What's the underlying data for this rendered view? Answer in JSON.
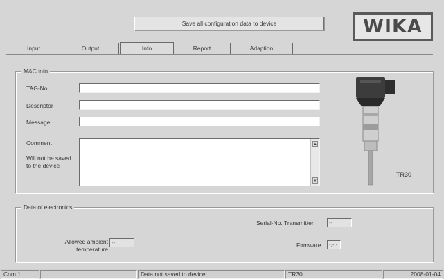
{
  "toolbar": {
    "save_label": "Save all configuration data to device"
  },
  "logo": {
    "text": "WIKA"
  },
  "tabs": [
    {
      "label": "Input"
    },
    {
      "label": "Output"
    },
    {
      "label": "Info",
      "active": true
    },
    {
      "label": "Report"
    },
    {
      "label": "Adaption"
    }
  ],
  "mc_info": {
    "title": "M&C info",
    "tag_label": "TAG-No.",
    "tag_value": "",
    "descriptor_label": "Descriptor",
    "descriptor_value": "",
    "message_label": "Message",
    "message_value": "",
    "comment_label": "Comment",
    "comment_note": "Will not be saved to the device",
    "comment_value": "",
    "device_name": "TR30"
  },
  "electronics": {
    "title": "Data of electronics",
    "serial_label": "Serial-No. Transmitter",
    "serial_value": "--",
    "ambient_label": "Allowed ambient temperature",
    "ambient_value": "--",
    "firmware_label": "Firmware",
    "firmware_value": "-.-.-"
  },
  "status_bar": {
    "port": "Com 1",
    "empty": "",
    "message": "Data not saved to device!",
    "device": "TR30",
    "date": "2008-01-04"
  },
  "colors": {
    "background": "#d6d6d6",
    "field": "#ffffff",
    "border": "#9a9a9a"
  }
}
